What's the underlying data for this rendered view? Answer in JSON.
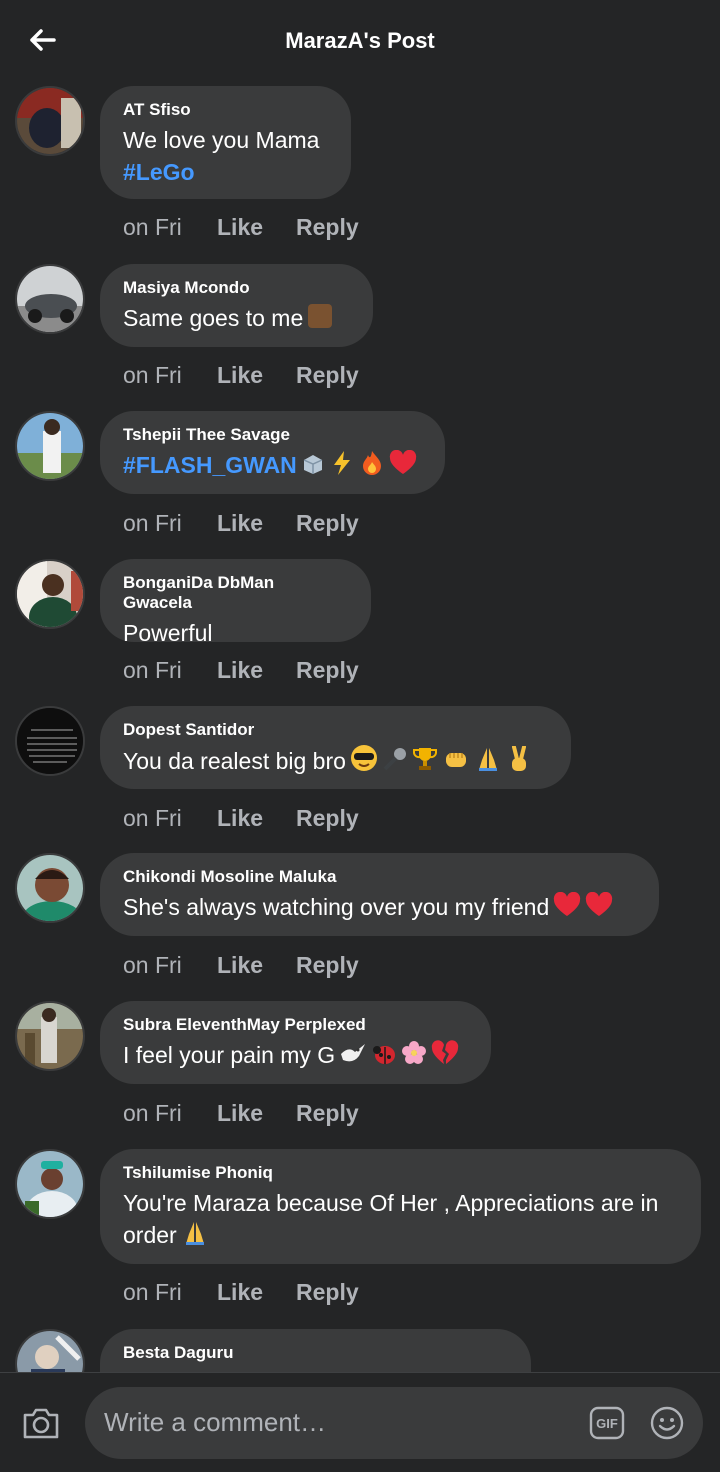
{
  "header": {
    "title": "MarazA's Post"
  },
  "comments": [
    {
      "author": "AT Sfiso",
      "text": "We love you Mama",
      "tag": "#LeGo",
      "time": "on Fri",
      "like": "Like",
      "reply": "Reply"
    },
    {
      "author": "Masiya Mcondo",
      "text": "Same goes to me",
      "time": "on Fri",
      "like": "Like",
      "reply": "Reply"
    },
    {
      "author": "Tshepii Thee Savage",
      "tag": "#FLASH_GWAN",
      "time": "on Fri",
      "like": "Like",
      "reply": "Reply"
    },
    {
      "author": "BonganiDa DbMan Gwacela",
      "text": "Powerful",
      "time": "on Fri",
      "like": "Like",
      "reply": "Reply"
    },
    {
      "author": "Dopest Santidor",
      "text": "You da realest big bro",
      "time": "on Fri",
      "like": "Like",
      "reply": "Reply"
    },
    {
      "author": "Chikondi Mosoline Maluka",
      "text": "She's always watching over you my friend",
      "time": "on Fri",
      "like": "Like",
      "reply": "Reply"
    },
    {
      "author": "Subra EleventhMay Perplexed",
      "text": "I feel your pain my G",
      "time": "on Fri",
      "like": "Like",
      "reply": "Reply"
    },
    {
      "author": "Tshilumise Phoniq",
      "text": "You're Maraza because Of Her , Appreciations are in order",
      "time": "on Fri",
      "like": "Like",
      "reply": "Reply"
    },
    {
      "author": "Besta Daguru"
    }
  ],
  "composer": {
    "placeholder": "Write a comment…",
    "gif_label": "GIF"
  },
  "icons": [
    "back-arrow-icon",
    "camera-icon",
    "gif-icon",
    "emoji-icon"
  ],
  "colors": {
    "background": "#242526",
    "bubble": "#3a3b3c",
    "hashtag": "#4599ff",
    "meta": "#b0b3b8"
  }
}
